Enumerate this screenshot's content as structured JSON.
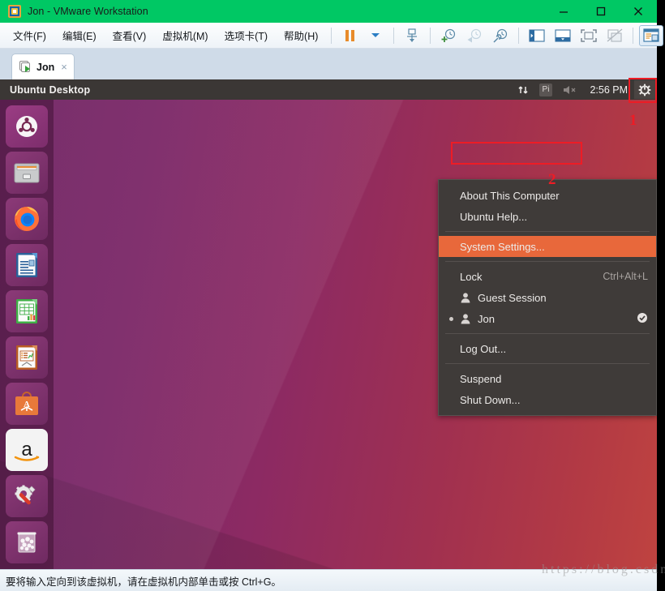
{
  "window": {
    "title": "Jon - VMware Workstation",
    "titlebar_color": "#00c864",
    "icon": "vmware-logo-icon",
    "controls": {
      "minimize": "minimize-icon",
      "maximize": "maximize-icon",
      "close": "close-icon"
    }
  },
  "menubar": {
    "items": [
      {
        "label": "文件(F)",
        "mnemonic": "F"
      },
      {
        "label": "编辑(E)",
        "mnemonic": "E"
      },
      {
        "label": "查看(V)",
        "mnemonic": "V"
      },
      {
        "label": "虚拟机(M)",
        "mnemonic": "M"
      },
      {
        "label": "选项卡(T)",
        "mnemonic": "T"
      },
      {
        "label": "帮助(H)",
        "mnemonic": "H"
      }
    ],
    "tools": [
      "pause-icon",
      "dropdown-caret-icon",
      "send-ctrl-alt-del-icon",
      "take-snapshot-icon",
      "revert-snapshot-icon",
      "snapshot-manager-icon",
      "show-sidebar-icon",
      "show-thumbnail-bar-icon",
      "enter-fullscreen-icon",
      "unity-mode-icon",
      "console-view-icon"
    ]
  },
  "tabs": [
    {
      "label": "Jon",
      "icon": "vm-powered-on-icon",
      "close": "×",
      "active": true
    }
  ],
  "vm": {
    "panel": {
      "title": "Ubuntu Desktop",
      "indicators": [
        {
          "name": "network-icon",
          "glyph": "⇅"
        },
        {
          "name": "input-source-indicator",
          "label": "Pi"
        },
        {
          "name": "volume-muted-icon",
          "glyph": "🔇"
        }
      ],
      "clock": "2:56 PM",
      "session_menu_icon": "gear-icon"
    },
    "launcher": {
      "items": [
        {
          "name": "ubuntu-dash-icon",
          "label": "Dash home"
        },
        {
          "name": "files-icon",
          "label": "Files"
        },
        {
          "name": "firefox-icon",
          "label": "Firefox Web Browser"
        },
        {
          "name": "libreoffice-writer-icon",
          "label": "LibreOffice Writer"
        },
        {
          "name": "libreoffice-calc-icon",
          "label": "LibreOffice Calc"
        },
        {
          "name": "libreoffice-impress-icon",
          "label": "LibreOffice Impress"
        },
        {
          "name": "ubuntu-software-icon",
          "label": "Ubuntu Software"
        },
        {
          "name": "amazon-icon",
          "label": "Amazon"
        },
        {
          "name": "system-settings-icon",
          "label": "System Settings"
        },
        {
          "name": "trash-icon",
          "label": "Trash"
        }
      ]
    },
    "session_menu": {
      "groups": [
        {
          "items": [
            {
              "label": "About This Computer",
              "accel": "",
              "icon": "",
              "highlight": false
            },
            {
              "label": "Ubuntu Help...",
              "accel": "",
              "icon": "",
              "highlight": false
            }
          ]
        },
        {
          "items": [
            {
              "label": "System Settings...",
              "accel": "",
              "icon": "",
              "highlight": true
            }
          ]
        },
        {
          "items": [
            {
              "label": "Lock",
              "accel": "Ctrl+Alt+L",
              "icon": "",
              "highlight": false
            },
            {
              "label": "Guest Session",
              "accel": "",
              "icon": "user-icon",
              "highlight": false
            },
            {
              "label": "Jon",
              "accel": "",
              "icon": "user-icon",
              "highlight": false,
              "bullet": true,
              "checked": true
            }
          ]
        },
        {
          "items": [
            {
              "label": "Log Out...",
              "accel": "",
              "icon": "",
              "highlight": false
            }
          ]
        },
        {
          "items": [
            {
              "label": "Suspend",
              "accel": "",
              "icon": "",
              "highlight": false
            },
            {
              "label": "Shut Down...",
              "accel": "",
              "icon": "",
              "highlight": false
            }
          ]
        }
      ]
    }
  },
  "annotations": {
    "color": "#ee1c25",
    "markers": [
      {
        "label": "1",
        "target": "gear-indicator"
      },
      {
        "label": "2",
        "target": "system-settings-menu-item"
      }
    ]
  },
  "watermark": {
    "text": "https://blog.csdn.net"
  },
  "statusbar": {
    "text": "要将输入定向到该虚拟机，请在虚拟机内部单击或按 Ctrl+G。"
  }
}
